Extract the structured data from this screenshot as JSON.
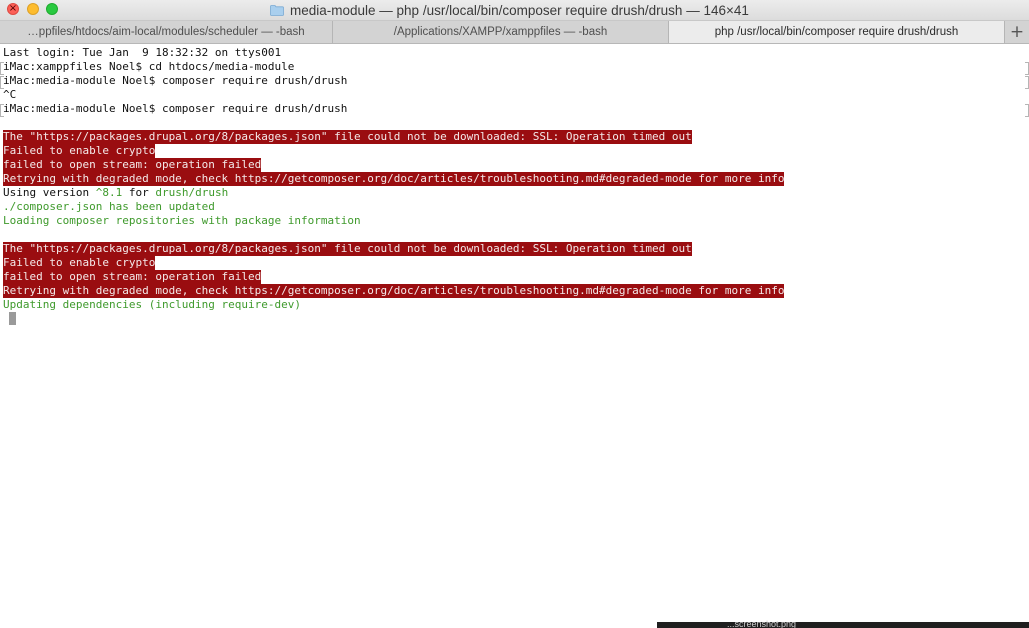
{
  "window": {
    "title": "media-module — php /usr/local/bin/composer require drush/drush — 146×41",
    "folder_icon": "folder-icon"
  },
  "tabs": [
    {
      "label": "…ppfiles/htdocs/aim-local/modules/scheduler — -bash",
      "active": false
    },
    {
      "label": "/Applications/XAMPP/xamppfiles — -bash",
      "active": false
    },
    {
      "label": "php /usr/local/bin/composer require drush/drush",
      "active": true
    }
  ],
  "tab_add_label": "+",
  "terminal": {
    "lines": [
      "Last login: Tue Jan  9 18:32:32 on ttys001",
      "iMac:xamppfiles Noel$ cd htdocs/media-module",
      "iMac:media-module Noel$ composer require drush/drush",
      "^C",
      "iMac:media-module Noel$ composer require drush/drush",
      "",
      "The \"https://packages.drupal.org/8/packages.json\" file could not be downloaded: SSL: Operation timed out",
      "Failed to enable crypto",
      "failed to open stream: operation failed",
      "Retrying with degraded mode, check https://getcomposer.org/doc/articles/troubleshooting.md#degraded-mode for more info",
      "Using version ",
      "./composer.json has been updated",
      "Loading composer repositories with package information",
      "",
      "The \"https://packages.drupal.org/8/packages.json\" file could not be downloaded: SSL: Operation timed out",
      "Failed to enable crypto",
      "failed to open stream: operation failed",
      "Retrying with degraded mode, check https://getcomposer.org/doc/articles/troubleshooting.md#degraded-mode for more info",
      "Updating dependencies (including require-dev)"
    ],
    "using_version": {
      "prefix": "Using version ",
      "version": "^8.1",
      "middle": " for ",
      "package": "drush/drush"
    }
  },
  "dock_hint": "...screenshot.png",
  "colors": {
    "error_bg": "#9a0d10",
    "success_text": "#3f9a2c"
  }
}
